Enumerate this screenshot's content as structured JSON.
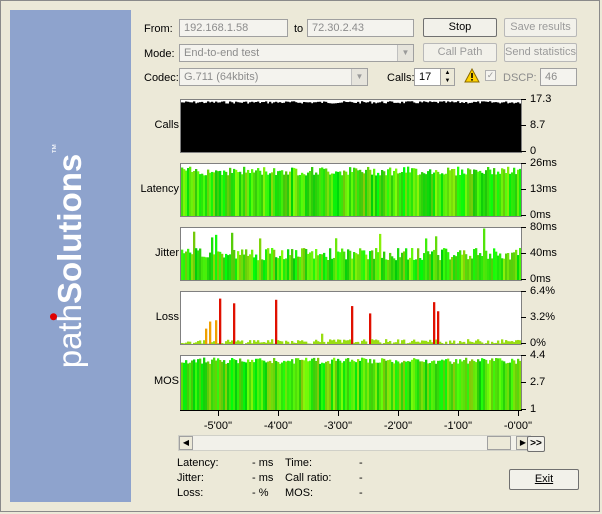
{
  "brand": {
    "name_thin": "path",
    "name_bold": "Solutions",
    "trademark": "™"
  },
  "form": {
    "from_label": "From:",
    "from_value": "192.168.1.58",
    "to_label": "to",
    "to_value": "72.30.2.43",
    "mode_label": "Mode:",
    "mode_value": "End-to-end test",
    "codec_label": "Codec:",
    "codec_value": "G.711 (64kbits)",
    "calls_label": "Calls:",
    "calls_value": "17",
    "dscp_label": "DSCP:",
    "dscp_value": "46"
  },
  "buttons": {
    "stop": "Stop",
    "save_results": "Save results",
    "call_path": "Call Path",
    "send_statistics": "Send statistics",
    "exit": "Exit",
    "fast_forward": ">>"
  },
  "chart_data": [
    {
      "type": "bar",
      "ylabel": "Calls",
      "ticks": [
        "17.3",
        "8.7",
        "0"
      ],
      "ylim": [
        0,
        17.3
      ],
      "color": "#000000",
      "level": 16.9
    },
    {
      "type": "bar",
      "ylabel": "Latency",
      "ticks": [
        "26ms",
        "13ms",
        "0ms"
      ],
      "ylim": [
        0,
        26
      ],
      "color": "#33dd11",
      "level": 22.5
    },
    {
      "type": "bar",
      "ylabel": "Jitter",
      "ticks": [
        "80ms",
        "40ms",
        "0ms"
      ],
      "ylim": [
        0,
        80
      ],
      "color": "#44dd11",
      "level": 38
    },
    {
      "type": "bar",
      "ylabel": "Loss",
      "ticks": [
        "6.4%",
        "3.2%",
        "0%"
      ],
      "ylim": [
        0,
        6.4
      ],
      "color": "#dd2200",
      "level": 0.5
    },
    {
      "type": "bar",
      "ylabel": "MOS",
      "ticks": [
        "4.4",
        "2.7",
        "1"
      ],
      "ylim": [
        1,
        4.4
      ],
      "color": "#55ee11",
      "level": 4.3
    }
  ],
  "x_axis": {
    "ticks": [
      "-5'00''",
      "-4'00''",
      "-3'00''",
      "-2'00''",
      "-1'00''",
      "-0'00''"
    ]
  },
  "stats": {
    "latency_label": "Latency:",
    "latency_value": "- ms",
    "jitter_label": "Jitter:",
    "jitter_value": "- ms",
    "loss_label": "Loss:",
    "loss_value": "- %",
    "time_label": "Time:",
    "time_value": "-",
    "call_ratio_label": "Call ratio:",
    "call_ratio_value": "-",
    "mos_label": "MOS:",
    "mos_value": "-"
  }
}
